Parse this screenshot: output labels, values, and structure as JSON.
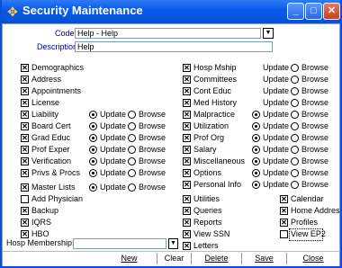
{
  "window": {
    "title": "Security Maintenance"
  },
  "form": {
    "code_label": "Code:",
    "code_value": "Help - Help",
    "description_label": "Description:",
    "description_value": "Help",
    "hosp_membership_label": "Hosp Membership:",
    "hosp_membership_value": ""
  },
  "radio_labels": {
    "update": "Update",
    "browse": "Browse"
  },
  "left_items": [
    {
      "label": "Demographics",
      "checked": true
    },
    {
      "label": "Address",
      "checked": true
    },
    {
      "label": "Appointments",
      "checked": true
    },
    {
      "label": "License",
      "checked": true
    },
    {
      "label": "Liability",
      "checked": true,
      "mode": "update"
    },
    {
      "label": "Board Cert",
      "checked": true,
      "mode": "update"
    },
    {
      "label": "Grad Educ",
      "checked": true,
      "mode": "update"
    },
    {
      "label": "Prof Exper",
      "checked": true,
      "mode": "update"
    },
    {
      "label": "Verification",
      "checked": true,
      "mode": "update"
    },
    {
      "label": "Privs & Procs",
      "checked": true,
      "mode": "update"
    },
    {
      "label": "Master Lists",
      "checked": true,
      "mode": "update"
    },
    {
      "label": "Add Physician",
      "checked": false
    },
    {
      "label": "Backup",
      "checked": true
    },
    {
      "label": "IQRS",
      "checked": true
    },
    {
      "label": "HBO",
      "checked": true
    }
  ],
  "mid_items": [
    {
      "label": "Hosp Mship",
      "checked": true,
      "mode": "none"
    },
    {
      "label": "Committees",
      "checked": true,
      "mode": "none"
    },
    {
      "label": "Cont Educ",
      "checked": true,
      "mode": "none"
    },
    {
      "label": "Med History",
      "checked": true,
      "mode": "none"
    },
    {
      "label": "Malpractice",
      "checked": true,
      "mode": "update"
    },
    {
      "label": "Utilization",
      "checked": true,
      "mode": "update"
    },
    {
      "label": "Prof Org",
      "checked": true,
      "mode": "update"
    },
    {
      "label": "Salary",
      "checked": true,
      "mode": "update"
    },
    {
      "label": "Miscellaneous",
      "checked": true,
      "mode": "update"
    },
    {
      "label": "Options",
      "checked": true,
      "mode": "update"
    },
    {
      "label": "Personal Info",
      "checked": true,
      "mode": "update"
    },
    {
      "label": "Utilities",
      "checked": true
    },
    {
      "label": "Queries",
      "checked": true
    },
    {
      "label": "Reports",
      "checked": true
    },
    {
      "label": "View SSN",
      "checked": true
    },
    {
      "label": "Letters",
      "checked": true
    }
  ],
  "right_items": [
    {
      "label": "Calendar",
      "checked": true
    },
    {
      "label": "Home Address",
      "checked": true
    },
    {
      "label": "Profiles",
      "checked": true
    },
    {
      "label": "View EP2",
      "checked": false
    }
  ],
  "buttons": {
    "new": "New",
    "clear": "Clear",
    "delete": "Delete",
    "save": "Save",
    "close": "Close"
  }
}
